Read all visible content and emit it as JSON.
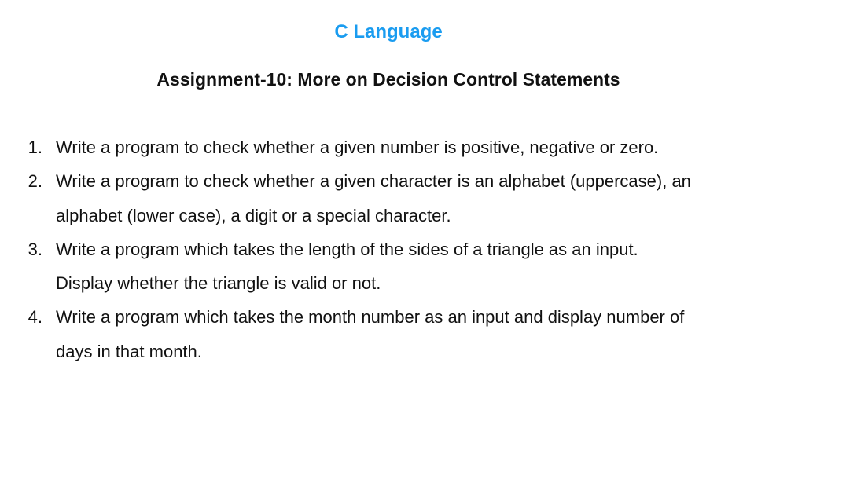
{
  "course_title": "C Language",
  "assignment_title": "Assignment-10: More on Decision Control Statements",
  "questions": [
    {
      "number": "1.",
      "lines": [
        "Write a program to check whether a given number is positive, negative or zero."
      ]
    },
    {
      "number": "2.",
      "lines": [
        "Write a program to check whether a given character is an alphabet (uppercase), an",
        "alphabet (lower case), a digit or a special character."
      ]
    },
    {
      "number": "3.",
      "lines": [
        "Write a program which takes the length of the sides of a triangle as an input.",
        "Display whether the triangle is valid or not."
      ]
    },
    {
      "number": "4.",
      "lines": [
        "Write a program which takes the month number as an input and display number of",
        "days in that month."
      ]
    }
  ],
  "colors": {
    "course_title": "#1a9cf0",
    "text": "#111111",
    "background": "#ffffff"
  }
}
